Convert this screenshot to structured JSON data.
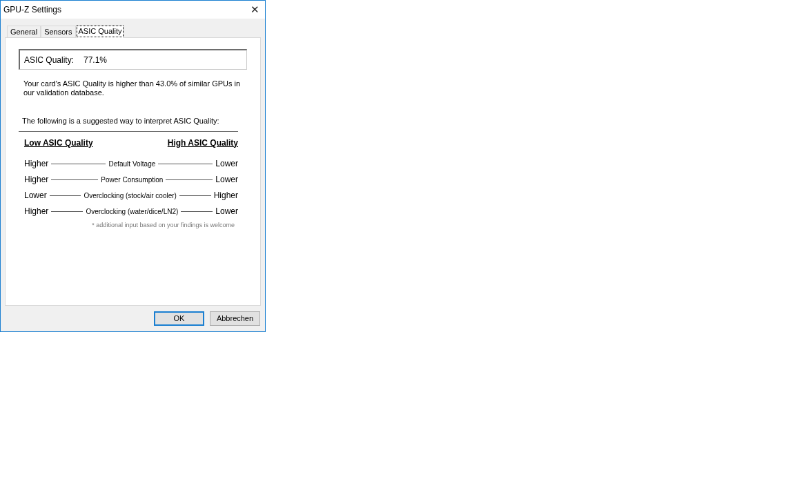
{
  "window": {
    "title": "GPU-Z Settings",
    "close": "✕"
  },
  "tabs": [
    {
      "label": "General",
      "selected": false
    },
    {
      "label": "Sensors",
      "selected": false
    },
    {
      "label": "ASIC Quality",
      "selected": true
    }
  ],
  "asic_field": {
    "label": "ASIC Quality:",
    "value": "77.1%"
  },
  "description": "Your card's ASIC Quality is higher than 43.0% of similar GPUs in our validation database.",
  "intro": "The following is a suggested way to interpret ASIC Quality:",
  "headers": {
    "low": "Low ASIC Quality",
    "high": "High ASIC Quality"
  },
  "rows": [
    {
      "left": "Higher",
      "middle": "Default Voltage",
      "right": "Lower"
    },
    {
      "left": "Higher",
      "middle": "Power Consumption",
      "right": "Lower"
    },
    {
      "left": "Lower",
      "middle": "Overclocking (stock/air cooler)",
      "right": "Higher"
    },
    {
      "left": "Higher",
      "middle": "Overclocking (water/dice/LN2)",
      "right": "Lower"
    }
  ],
  "footnote": "* additional input based on your findings is welcome",
  "buttons": [
    {
      "label": "OK",
      "default": true
    },
    {
      "label": "Abbrechen",
      "default": false
    }
  ]
}
